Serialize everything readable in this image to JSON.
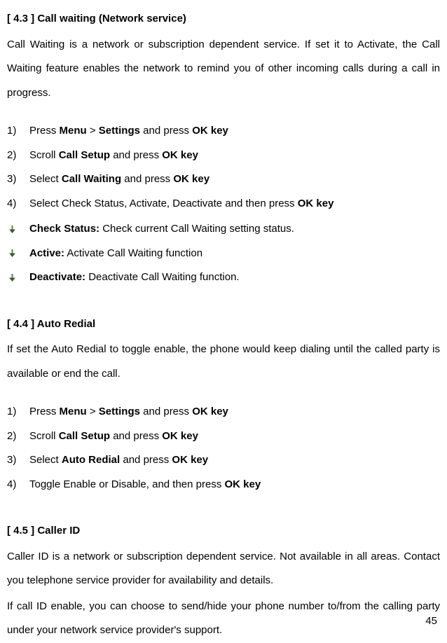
{
  "section43": {
    "heading": "[ 4.3 ]    Call waiting (Network service)",
    "intro": "Call Waiting is a network or subscription dependent service. If set it to Activate, the Call Waiting feature enables the network to remind you of other incoming calls during a call in progress.",
    "steps": [
      {
        "num": "1)",
        "pre": "Press ",
        "b1": "Menu",
        "mid1": " > ",
        "b2": "Settings",
        "mid2": " and press ",
        "b3": "OK key",
        "post": ""
      },
      {
        "num": "2)",
        "pre": "Scroll ",
        "b1": "Call Setup",
        "mid1": " and press ",
        "b2": "OK key",
        "mid2": "",
        "b3": "",
        "post": ""
      },
      {
        "num": "3)",
        "pre": "Select ",
        "b1": "Call Waiting",
        "mid1": " and press ",
        "b2": "OK key",
        "mid2": "",
        "b3": "",
        "post": ""
      },
      {
        "num": "4)",
        "pre": "Select Check Status, Activate, Deactivate and then press ",
        "b1": "OK key",
        "mid1": "",
        "b2": "",
        "mid2": "",
        "b3": "",
        "post": ""
      }
    ],
    "bullets": [
      {
        "label": "Check Status:",
        "desc": " Check current Call Waiting setting status."
      },
      {
        "label": "Active:",
        "desc": " Activate Call Waiting function"
      },
      {
        "label": "Deactivate:",
        "desc": " Deactivate Call Waiting function."
      }
    ]
  },
  "section44": {
    "heading": "[ 4.4 ]    Auto Redial",
    "intro": "If set the Auto Redial to toggle enable, the phone would keep dialing until the called party is available or end the call.",
    "steps": [
      {
        "num": "1)",
        "pre": "Press ",
        "b1": "Menu",
        "mid1": " > ",
        "b2": "Settings",
        "mid2": " and press ",
        "b3": "OK key",
        "post": ""
      },
      {
        "num": "2)",
        "pre": "Scroll ",
        "b1": "Call Setup",
        "mid1": " and press ",
        "b2": "OK key",
        "mid2": "",
        "b3": "",
        "post": ""
      },
      {
        "num": "3)",
        "pre": "Select ",
        "b1": "Auto Redial",
        "mid1": " and press ",
        "b2": "OK key",
        "mid2": "",
        "b3": "",
        "post": ""
      },
      {
        "num": "4)",
        "pre": "Toggle Enable or Disable, and then press ",
        "b1": "OK key",
        "mid1": "",
        "b2": "",
        "mid2": "",
        "b3": "",
        "post": ""
      }
    ]
  },
  "section45": {
    "heading": "[ 4.5 ]    Caller ID",
    "intro1": "Caller ID is a network or subscription dependent service. Not available in all areas. Contact you telephone service provider for availability and details.",
    "intro2": "If call ID enable, you can choose to send/hide your phone number to/from the calling party under your network service provider's support."
  },
  "pageNumber": "45"
}
